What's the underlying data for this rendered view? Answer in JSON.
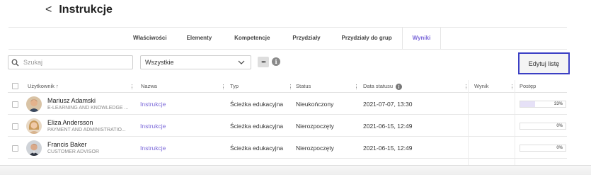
{
  "header": {
    "back_symbol": "<",
    "title": "Instrukcje"
  },
  "tabs": [
    {
      "label": "Właściwości",
      "active": false
    },
    {
      "label": "Elementy",
      "active": false
    },
    {
      "label": "Kompetencje",
      "active": false
    },
    {
      "label": "Przydziały",
      "active": false
    },
    {
      "label": "Przydziały do grup",
      "active": false
    },
    {
      "label": "Wyniki",
      "active": true
    }
  ],
  "filters": {
    "search_placeholder": "Szukaj",
    "select_value": "Wszystkie",
    "more_label": "•••",
    "info_label": "i",
    "edit_button": "Edytuj listę"
  },
  "table": {
    "columns": {
      "user": "Użytkownik ↑",
      "name": "Nazwa",
      "type": "Typ",
      "status": "Status",
      "status_date": "Data statusu",
      "result": "Wynik",
      "progress": "Postęp"
    },
    "rows": [
      {
        "user_name": "Mariusz Adamski",
        "user_sub": "E-LEARNING AND KNOWLEDGE ...",
        "name": "Instrukcje",
        "type": "Ścieżka edukacyjna",
        "status": "Nieukończony",
        "status_date": "2021-07-07, 13:30",
        "result": "",
        "progress_label": "33%",
        "progress_value": 0.33
      },
      {
        "user_name": "Eliza Andersson",
        "user_sub": "PAYMENT AND ADMINISTRATIO...",
        "name": "Instrukcje",
        "type": "Ścieżka edukacyjna",
        "status": "Nierozpoczęty",
        "status_date": "2021-06-15, 12:49",
        "result": "",
        "progress_label": "0%",
        "progress_value": 0
      },
      {
        "user_name": "Francis Baker",
        "user_sub": "CUSTOMER ADVISOR",
        "name": "Instrukcje",
        "type": "Ścieżka edukacyjna",
        "status": "Nierozpoczęty",
        "status_date": "2021-06-15, 12:49",
        "result": "",
        "progress_label": "0%",
        "progress_value": 0
      }
    ]
  },
  "colors": {
    "accent": "#7b68d9",
    "edit_border": "#3b3fc4"
  }
}
